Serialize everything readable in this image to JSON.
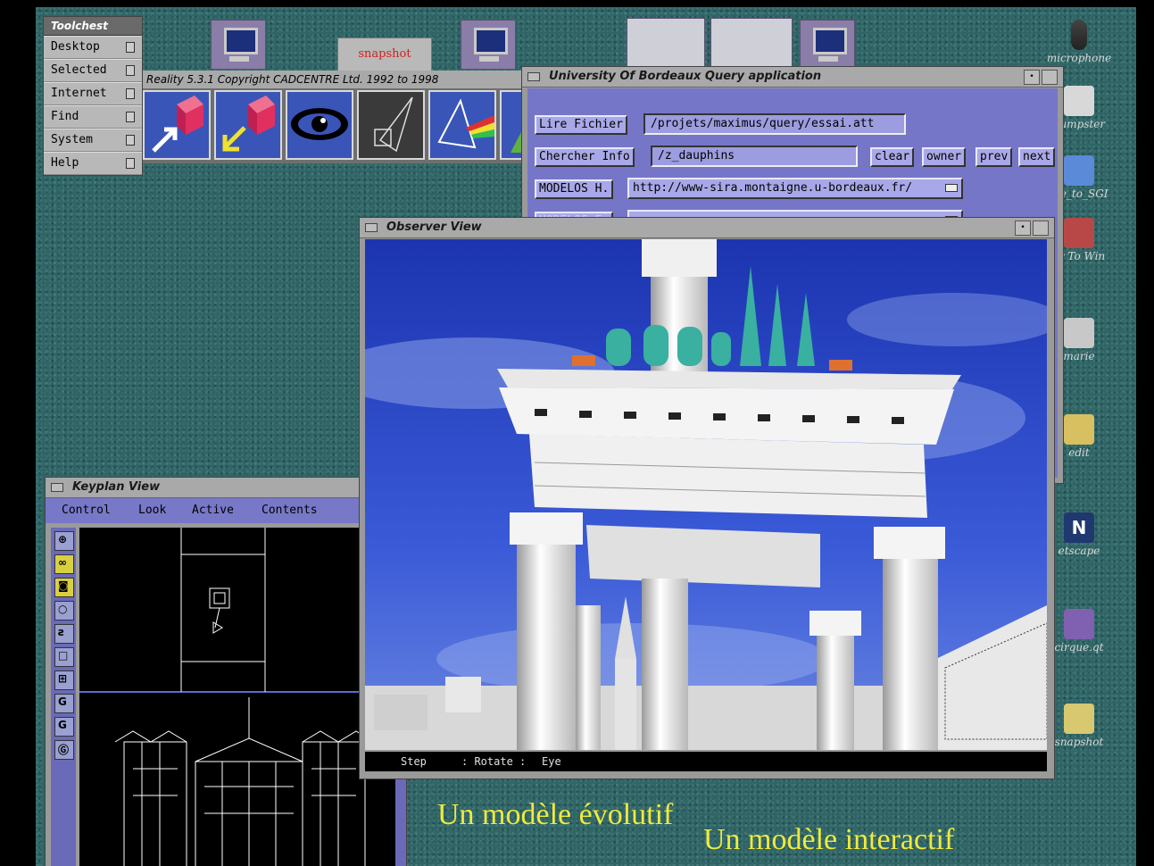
{
  "toolchest": {
    "title": "Toolchest",
    "items": [
      {
        "label": "Desktop"
      },
      {
        "label": "Selected"
      },
      {
        "label": "Internet"
      },
      {
        "label": "Find"
      },
      {
        "label": "System"
      },
      {
        "label": "Help"
      }
    ]
  },
  "desktop_top": {
    "snapshot_label": "snapshot"
  },
  "vr_window": {
    "title": "Reality 5.3.1 Copyright CADCENTRE Ltd. 1992 to 1998",
    "tools": [
      "move-out-icon",
      "move-in-icon",
      "eye-icon",
      "wireframe-cube-icon",
      "prism-icon",
      "cone-icon"
    ]
  },
  "desktop_icons": [
    {
      "label": "microphone",
      "icon": "microphone-icon"
    },
    {
      "label": "dumpster",
      "icon": "printer-icon"
    },
    {
      "label": "me_to_SGI",
      "icon": "network-icon"
    },
    {
      "label": "er To Win",
      "icon": "toolbox-icon"
    },
    {
      "label": "marie",
      "icon": "folder-icon"
    },
    {
      "label": "edit",
      "icon": "edit-icon"
    },
    {
      "label": "etscape",
      "icon": "netscape-icon"
    },
    {
      "label": "cirque.qt",
      "icon": "movie-icon"
    },
    {
      "label": "snapshot",
      "icon": "camera-icon"
    }
  ],
  "query_window": {
    "title": "University Of Bordeaux Query application",
    "lire_fichier_label": "Lire Fichier",
    "file_path": "/projets/maximus/query/essai.att",
    "chercher_info_label": "Chercher Info",
    "search_value": "/z_dauphins",
    "clear_label": "clear",
    "owner_label": "owner",
    "prev_label": "prev",
    "next_label": "next",
    "modelos_h_label": "MODELOS H.",
    "modelos_h_url": "http://www-sira.montaigne.u-bordeaux.fr/",
    "modelos_e_label": "MODELOS E."
  },
  "observer_window": {
    "title": "Observer View",
    "status_step": "Step",
    "status_mode": ": Rotate :",
    "status_target": "Eye"
  },
  "keyplan_window": {
    "title": "Keyplan View",
    "menu": [
      "Control",
      "Look",
      "Active",
      "Contents"
    ],
    "tools": [
      "zoom-icon",
      "walk-icon",
      "camera-icon",
      "light-icon",
      "path-icon",
      "box-icon",
      "grid-icon",
      "g-icon",
      "g-rotate-icon",
      "g-circle-icon"
    ]
  },
  "captions": {
    "line1": "Un modèle évolutif",
    "line2": "Un modèle interactif"
  },
  "colors": {
    "desktop": "#2f6566",
    "panel_blue": "#7676c8",
    "caption_yellow": "#f0ea3c",
    "sky_blue": "#2a48c8"
  }
}
